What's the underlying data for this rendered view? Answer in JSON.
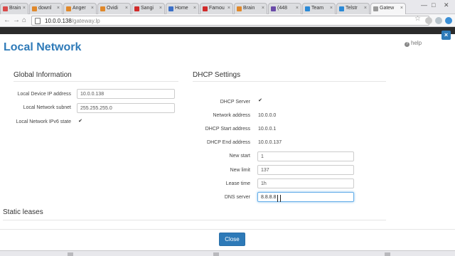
{
  "browser": {
    "tabs": [
      {
        "label": "Brain",
        "color": "#d94a4a"
      },
      {
        "label": "downl",
        "color": "#e0882b"
      },
      {
        "label": "Anger",
        "color": "#e0882b"
      },
      {
        "label": "Ovidi",
        "color": "#e0882b"
      },
      {
        "label": "Sangi",
        "color": "#d12a2a"
      },
      {
        "label": "Home",
        "color": "#3b6fc7"
      },
      {
        "label": "Famou",
        "color": "#d12a2a"
      },
      {
        "label": "Brain",
        "color": "#e0882b"
      },
      {
        "label": "(448",
        "color": "#6a4aa8"
      },
      {
        "label": "Team",
        "color": "#2a89d6"
      },
      {
        "label": "Telstr",
        "color": "#2a89d6"
      },
      {
        "label": "Gatew",
        "color": "#9a9a9a"
      }
    ],
    "address_host": "10.0.0.138",
    "address_path": "/gateway.lp",
    "window_controls": {
      "minimize": "—",
      "maximize": "□",
      "close": "✕"
    }
  },
  "modal": {
    "title": "Local Network",
    "help_label": "help",
    "close_icon": "×",
    "global": {
      "heading": "Global Information",
      "rows": [
        {
          "label": "Local Device IP address",
          "value": "10.0.0.138"
        },
        {
          "label": "Local Network subnet",
          "value": "255.255.255.0"
        },
        {
          "label": "Local Network IPv6 state",
          "checked": true
        }
      ]
    },
    "dhcp": {
      "heading": "DHCP Settings",
      "server_label": "DHCP Server",
      "server_checked": true,
      "static_rows": [
        {
          "label": "Network address",
          "value": "10.0.0.0"
        },
        {
          "label": "DHCP Start address",
          "value": "10.0.0.1"
        },
        {
          "label": "DHCP End address",
          "value": "10.0.0.137"
        }
      ],
      "input_rows": [
        {
          "label": "New start",
          "value": "1"
        },
        {
          "label": "New limit",
          "value": "137"
        },
        {
          "label": "Lease time",
          "value": "1h"
        },
        {
          "label": "DNS server",
          "value": "8.8.8.8"
        }
      ]
    },
    "static_leases_heading": "Static leases",
    "close_button": "Close"
  },
  "theme": {
    "accent": "#2e7ab8",
    "header_dark": "#2b2b2b"
  }
}
